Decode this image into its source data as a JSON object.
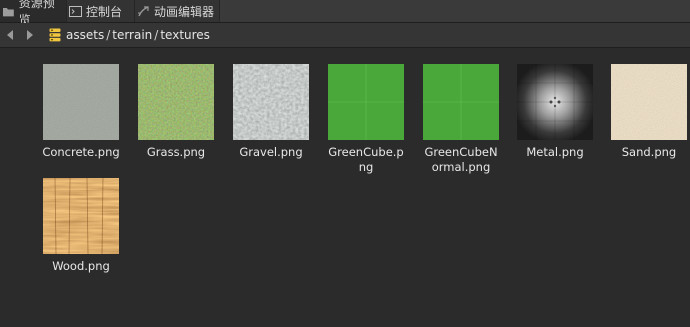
{
  "tabs": [
    {
      "label": "资源预览",
      "icon": "folder-icon"
    },
    {
      "label": "控制台",
      "icon": "console-icon"
    },
    {
      "label": "动画编辑器",
      "icon": "animation-icon"
    }
  ],
  "path": {
    "icon": "database-icon",
    "segments": [
      "assets",
      "terrain",
      "textures"
    ],
    "separator": "/"
  },
  "files": [
    {
      "name": "Concrete.png",
      "texture": "concrete"
    },
    {
      "name": "Grass.png",
      "texture": "grass"
    },
    {
      "name": "Gravel.png",
      "texture": "gravel"
    },
    {
      "name": "GreenCube.png",
      "texture": "green"
    },
    {
      "name": "GreenCubeNormal.png",
      "texture": "green"
    },
    {
      "name": "Metal.png",
      "texture": "metal"
    },
    {
      "name": "Sand.png",
      "texture": "sand"
    },
    {
      "name": "Wood.png",
      "texture": "wood"
    }
  ],
  "colors": {
    "background": "#2b2b2b",
    "green": "#4aa83a",
    "folder_icon": "#f0c640"
  }
}
